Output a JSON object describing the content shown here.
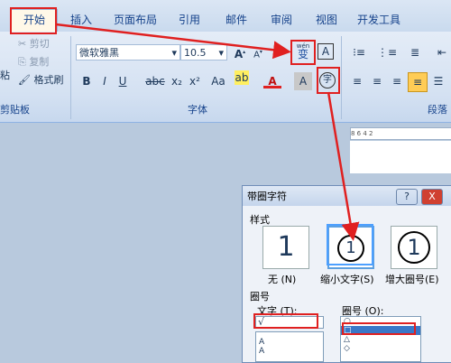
{
  "tabs": [
    "开始",
    "插入",
    "页面布局",
    "引用",
    "邮件",
    "审阅",
    "视图",
    "开发工具"
  ],
  "clipboard": {
    "cut": "剪切",
    "copy": "复制",
    "format_painter": "格式刷",
    "paste_partial": "粘",
    "group_label": "剪贴板"
  },
  "font": {
    "name": "微软雅黑",
    "size": "10.5",
    "group_label": "字体",
    "phonetic_glyph": "wén",
    "phonetic_char": "变",
    "charborder": "A",
    "enclose_char": "字"
  },
  "format_buttons": [
    "B",
    "I",
    "U",
    "abc",
    "x₂",
    "x²",
    "Aa",
    "A",
    "A"
  ],
  "paragraph": {
    "group_label": "段落"
  },
  "ruler": {
    "marks": "8   6   4   2"
  },
  "dialog": {
    "title": "带圈字符",
    "help": "?",
    "close": "X",
    "style_label": "样式",
    "styles": [
      {
        "label": "无 (N)",
        "glyph": "1"
      },
      {
        "label": "缩小文字(S)",
        "glyph": "1"
      },
      {
        "label": "增大圈号(E)",
        "glyph": "1"
      }
    ],
    "circle_label": "圈号",
    "text_label": "文字 (T):",
    "text_value": "√",
    "text_list": [
      "A",
      "A"
    ],
    "shape_label": "圈号 (O):",
    "shapes": [
      "○",
      "□",
      "△",
      "◇"
    ]
  },
  "colors": {
    "accent": "#e02020",
    "tab_text": "#15428b"
  }
}
